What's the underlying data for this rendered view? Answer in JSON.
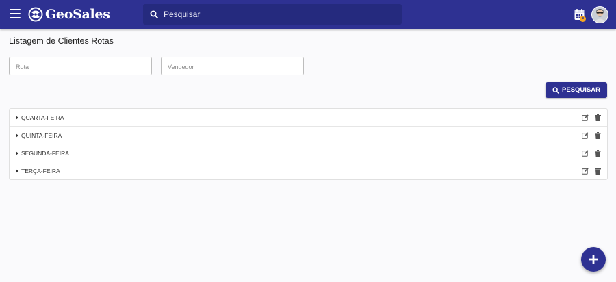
{
  "app": {
    "brand_name": "GeoSales",
    "accent_color": "#2e3192",
    "badge_color": "#f5a623"
  },
  "header": {
    "search_placeholder": "Pesquisar",
    "notification_badge": "5"
  },
  "page": {
    "title": "Listagem de Clientes Rotas"
  },
  "filters": {
    "rota_placeholder": "Rota",
    "vendedor_placeholder": "Vendedor",
    "search_button_label": "PESQUISAR"
  },
  "routes": [
    {
      "label": "QUARTA-FEIRA"
    },
    {
      "label": "QUINTA-FEIRA"
    },
    {
      "label": "SEGUNDA-FEIRA"
    },
    {
      "label": "TERÇA-FEIRA"
    }
  ],
  "icons": {
    "menu": "menu-icon",
    "logo": "logo-icon",
    "search": "search-icon",
    "calendar": "calendar-icon",
    "edit": "edit-icon",
    "trash": "trash-icon",
    "add": "plus-icon",
    "expand": "caret-right-icon"
  }
}
